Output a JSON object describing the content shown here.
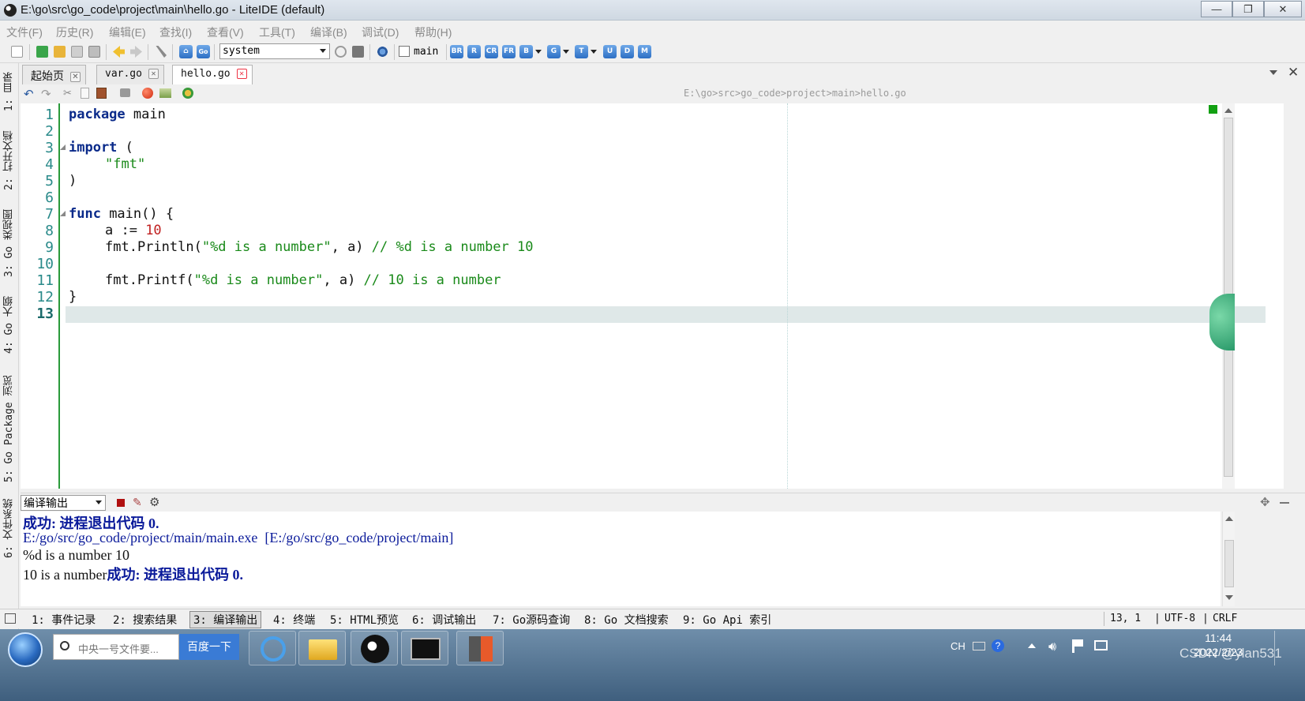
{
  "window": {
    "title": "E:\\go\\src\\go_code\\project\\main\\hello.go - LiteIDE (default)",
    "minimize": "—",
    "maximize": "❐",
    "close": "✕"
  },
  "menu": [
    "文件(F)",
    "历史(R)",
    "编辑(E)",
    "查找(I)",
    "查看(V)",
    "工具(T)",
    "编译(B)",
    "调试(D)",
    "帮助(H)"
  ],
  "toolbar": {
    "env_select": "system",
    "target_checkbox": "main",
    "build_buttons": [
      "BR",
      "R",
      "CR",
      "FR",
      "B",
      "G",
      "T",
      "U",
      "D",
      "M"
    ]
  },
  "tabs": [
    {
      "label": "起始页",
      "active": false
    },
    {
      "label": "var.go",
      "active": false
    },
    {
      "label": "hello.go",
      "active": true
    }
  ],
  "editor": {
    "path": "E:\\go>src>go_code>project>main>hello.go",
    "line_numbers": [
      "1",
      "2",
      "3",
      "4",
      "5",
      "6",
      "7",
      "8",
      "9",
      "10",
      "11",
      "12",
      "13"
    ],
    "lines": {
      "l1_kw": "package",
      "l1_rest": " main",
      "l3_kw": "import",
      "l3_rest": " (",
      "l4_str": "\"fmt\"",
      "l5": ")",
      "l7_kw": "func",
      "l7_rest": " main() {",
      "l8_a": "a := ",
      "l8_num": "10",
      "l9_a": "fmt.Println(",
      "l9_str": "\"%d is a number\"",
      "l9_b": ", a) ",
      "l9_com": "// %d is a number 10",
      "l11_a": "fmt.Printf(",
      "l11_str": "\"%d is a number\"",
      "l11_b": ", a) ",
      "l11_com": "// 10 is a number",
      "l12": "}"
    }
  },
  "left_tabs": [
    "1: 目录",
    "2: 打开文档",
    "3: Go 类视图",
    "4: Go 大纲",
    "5: Go Package 浏览",
    "6: 文件系统"
  ],
  "output": {
    "selector": "编译输出",
    "lines": [
      {
        "text": "成功: 进程退出代码 0.",
        "color": "#0a1a9a",
        "bold": true
      },
      {
        "text": "E:/go/src/go_code/project/main/main.exe  [E:/go/src/go_code/project/main]",
        "color": "#0a1a9a",
        "bold": false
      },
      {
        "text": "%d is a number 10",
        "color": "#111111",
        "bold": false
      },
      {
        "text": "10 is a number",
        "color": "#111111",
        "bold": false
      }
    ],
    "suffix_success": "成功: 进程退出代码 0."
  },
  "bottom_tabs": [
    "1: 事件记录",
    "2: 搜索结果",
    "3: 编译输出",
    "4: 终端",
    "5: HTML预览",
    "6: 调试输出",
    "7: Go源码查询",
    "8: Go 文档搜索",
    "9: Go Api 索引"
  ],
  "status": {
    "position": "13,  1",
    "encoding": "UTF-8",
    "line_ending": "CRLF"
  },
  "taskbar": {
    "search_placeholder": "中央一号文件要...",
    "search_button": "百度一下",
    "lang": "CH",
    "time": "11:44",
    "date": "2022/2/23",
    "watermark": "CSDN @ylan531"
  },
  "colors": {
    "keyword": "#0a2a8a",
    "string": "#1a8a1a",
    "number": "#c02020",
    "comment": "#1a8a1a",
    "output_blue": "#0a1a9a"
  }
}
